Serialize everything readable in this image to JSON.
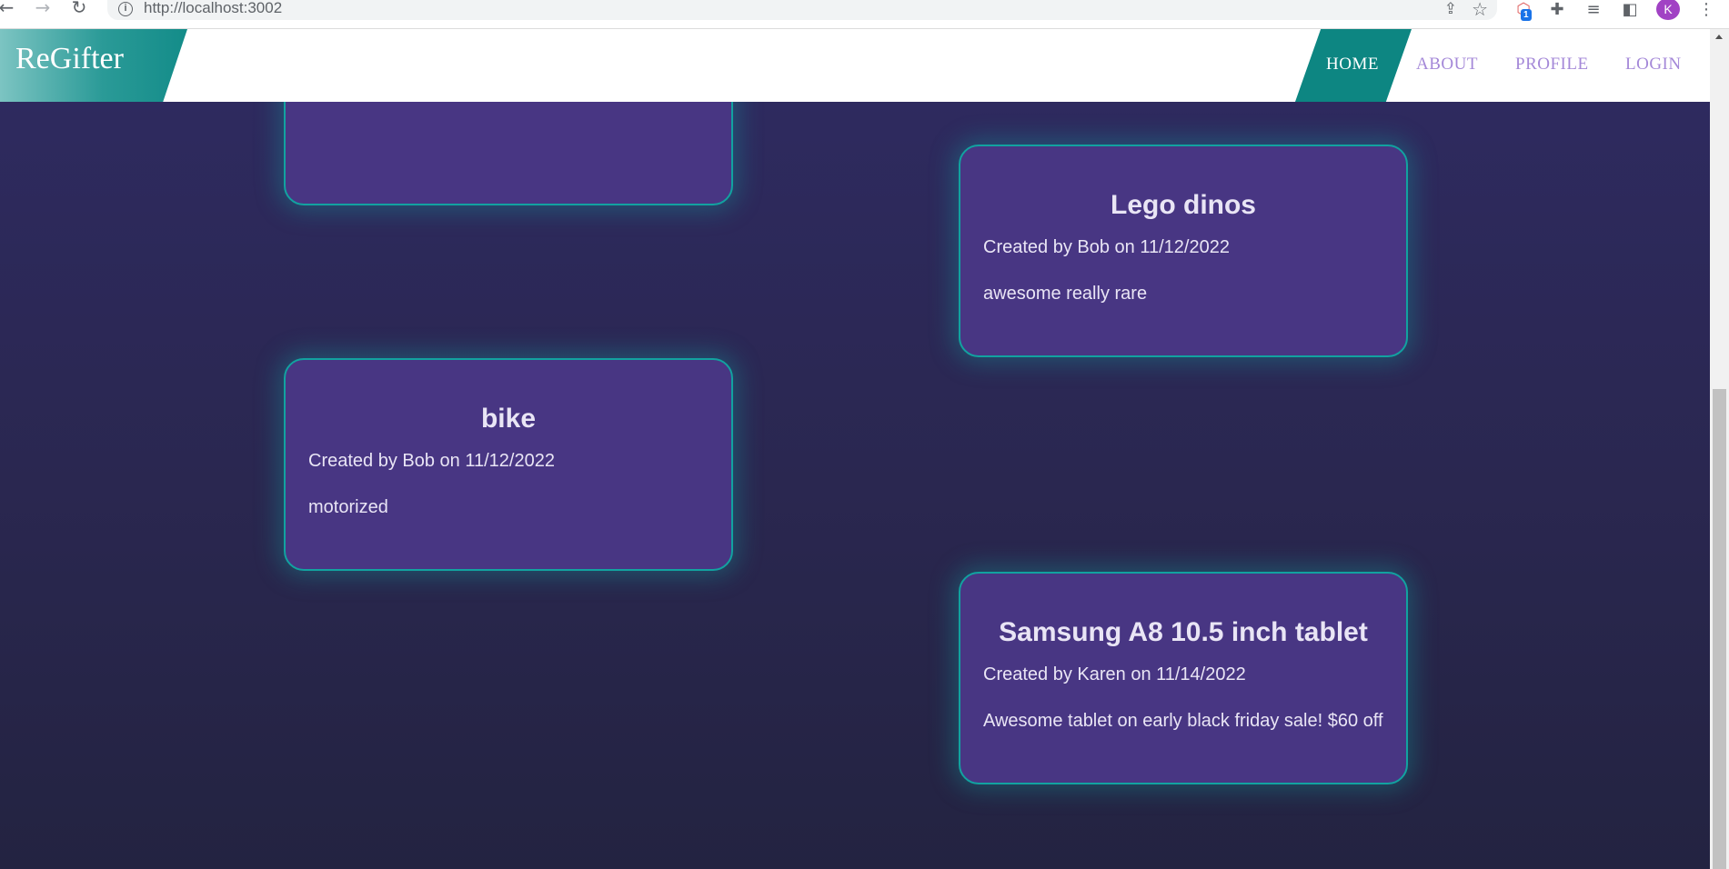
{
  "browser": {
    "url": "http://localhost:3002",
    "extension_badge": "1",
    "avatar_initial": "K"
  },
  "site": {
    "logo": "ReGifter",
    "nav": [
      {
        "label": "HOME",
        "active": true
      },
      {
        "label": "ABOUT",
        "active": false
      },
      {
        "label": "PROFILE",
        "active": false
      },
      {
        "label": "LOGIN",
        "active": false
      }
    ]
  },
  "colors": {
    "teal_accent": "#0d8682",
    "card_bg": "#483683",
    "card_border": "#12a2a0",
    "page_bg": "#2b2850",
    "nav_link": "#a488d8"
  },
  "cards": [
    {
      "title": "",
      "meta": "",
      "description": ""
    },
    {
      "title": "Lego dinos",
      "meta": "Created by Bob on 11/12/2022",
      "description": "awesome really rare"
    },
    {
      "title": "bike",
      "meta": "Created by Bob on 11/12/2022",
      "description": "motorized"
    },
    {
      "title": "Samsung A8 10.5 inch tablet",
      "meta": "Created by Karen on 11/14/2022",
      "description": "Awesome tablet on early black friday sale! $60 off"
    }
  ]
}
